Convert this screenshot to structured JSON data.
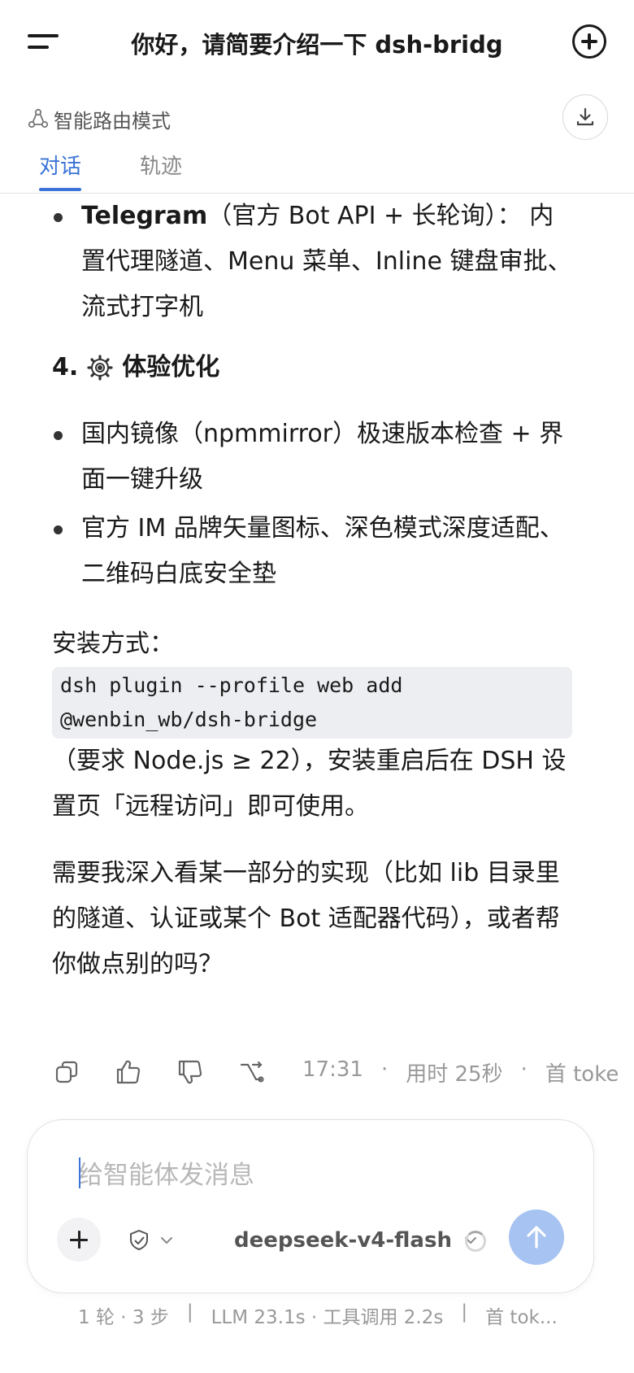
{
  "header": {
    "title": "你好，请简要介绍一下 dsh-bridg",
    "menu_icon": "menu-icon",
    "new_chat_icon": "plus-circle-icon"
  },
  "mode": {
    "label": "智能路由模式",
    "icon": "route-icon",
    "download_icon": "download-icon"
  },
  "tabs": [
    {
      "label": "对话",
      "active": true
    },
    {
      "label": "轨迹",
      "active": false
    }
  ],
  "message": {
    "telegram": {
      "name": "Telegram",
      "text": "（官方 Bot API + 长轮询）： 内置代理隧道、Menu 菜单、Inline 键盘审批、流式打字机"
    },
    "section4": {
      "number": "4.",
      "icon": "gear-icon",
      "title": "体验优化"
    },
    "bullets": [
      "国内镜像（npmmirror）极速版本检查 + 界面一键升级",
      "官方 IM 品牌矢量图标、深色模式深度适配、二维码白底安全垫"
    ],
    "install_label": "安装方式：",
    "install_code": "dsh plugin --profile web add @wenbin_wb/dsh-bridge",
    "install_note": "（要求 Node.js ≥ 22），安装重启后在 DSH 设置页「远程访问」即可使用。",
    "closing": "需要我深入看某一部分的实现（比如 lib 目录里的隧道、认证或某个 Bot 适配器代码），或者帮你做点别的吗？"
  },
  "actions": {
    "time": "17:31",
    "sep": "·",
    "duration": "用时 25秒",
    "first_token": "首 toke"
  },
  "composer": {
    "placeholder": "给智能体发消息",
    "model": "deepseek-v4-flash",
    "accent": "#3b74d6",
    "send_color": "#a6c3f2"
  },
  "footer": {
    "rounds": "1 轮 · 3 步",
    "divider": "|",
    "llm": "LLM 23.1s · 工具调用 2.2s",
    "first": "首 tok..."
  }
}
